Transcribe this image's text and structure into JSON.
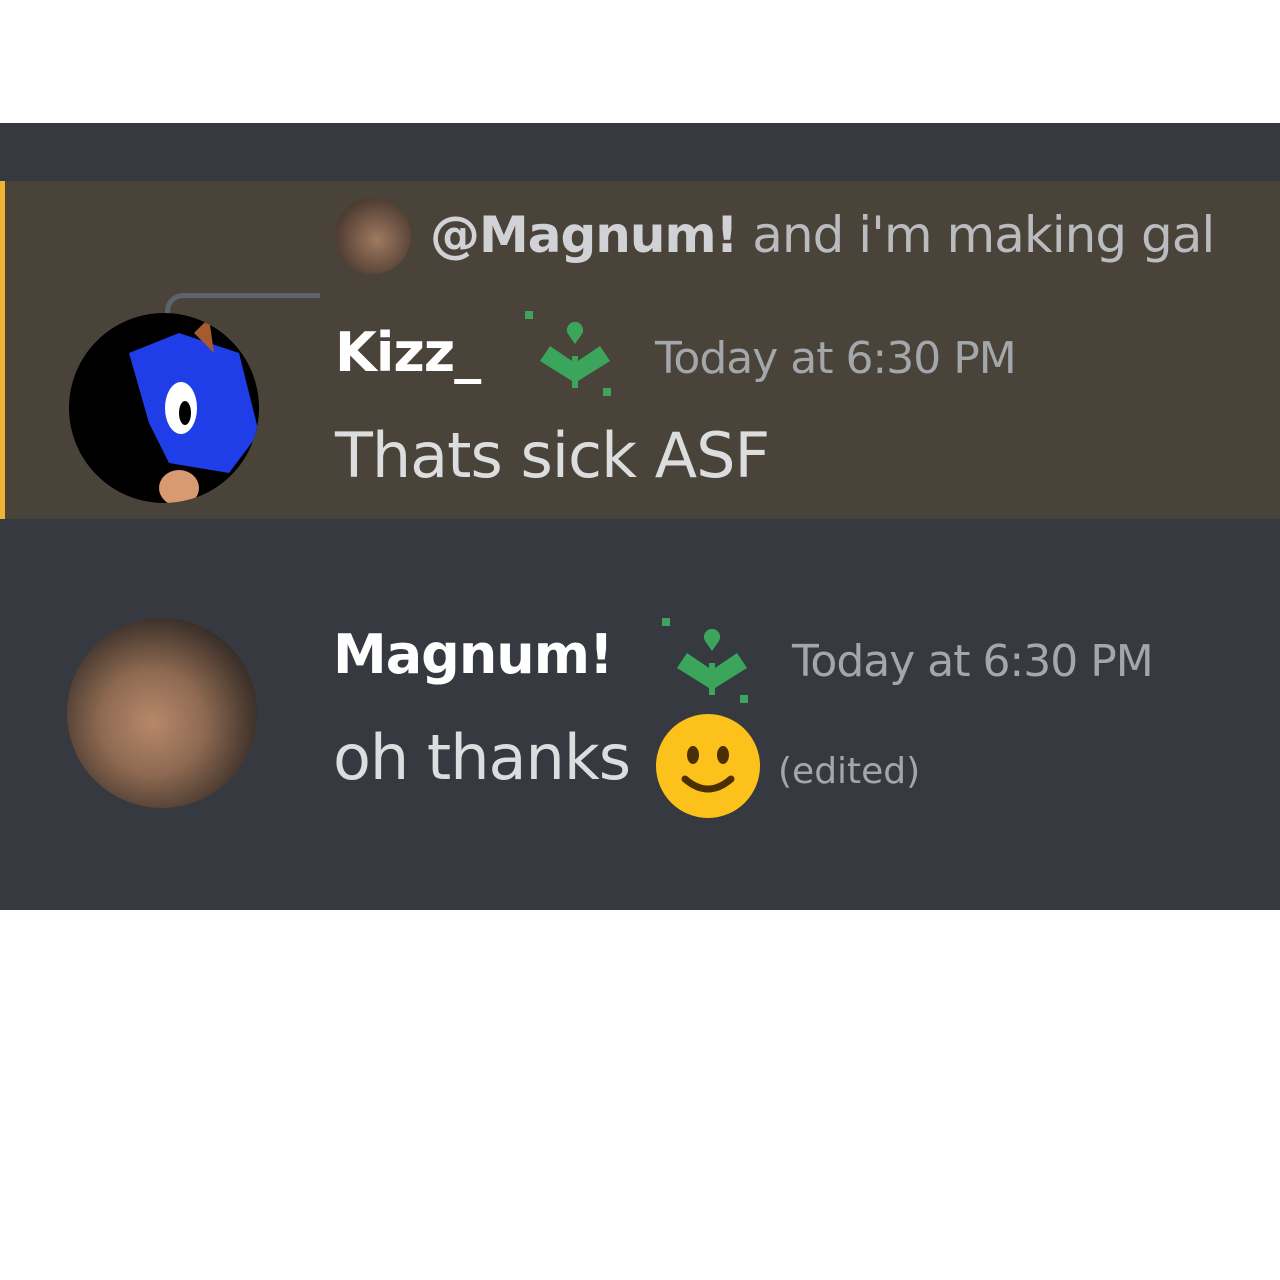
{
  "messages": [
    {
      "highlighted": true,
      "reply": {
        "mention": "@Magnum!",
        "text": "and i'm making gal"
      },
      "author": "Kizz_",
      "badge_icon": "sprout-badge-icon",
      "timestamp": "Today at 6:30 PM",
      "content": "Thats sick ASF"
    },
    {
      "highlighted": false,
      "author": "Magnum!",
      "badge_icon": "sprout-badge-icon",
      "timestamp": "Today at 6:30 PM",
      "content": "oh thanks",
      "emoji": "slightly-smiling-face",
      "edited_label": "(edited)"
    }
  ],
  "colors": {
    "background": "#36393f",
    "mention_highlight": "#4a4339",
    "highlight_border": "#f0b232",
    "badge": "#3ba55c"
  }
}
